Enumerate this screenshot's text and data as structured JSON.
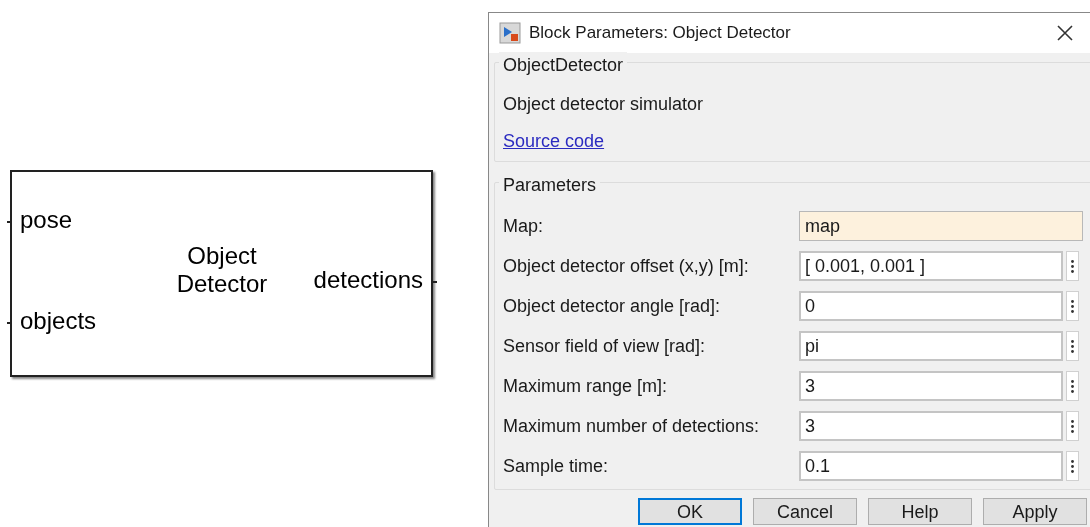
{
  "block": {
    "name": [
      "Object",
      "Detector"
    ],
    "inputs": [
      "pose",
      "objects"
    ],
    "outputs": [
      "detections"
    ]
  },
  "dialog": {
    "title": "Block Parameters: Object Detector",
    "group": {
      "title": "ObjectDetector",
      "description": "Object detector simulator",
      "link": "Source code"
    },
    "parameters_title": "Parameters",
    "fields": [
      {
        "label": "Map:",
        "value": "map",
        "kind": "expression"
      },
      {
        "label": "Object detector offset (x,y) [m]:",
        "value": "[ 0.001, 0.001 ]",
        "kind": "edit"
      },
      {
        "label": "Object detector angle [rad]:",
        "value": "0",
        "kind": "edit"
      },
      {
        "label": "Sensor field of view [rad]:",
        "value": "pi",
        "kind": "edit"
      },
      {
        "label": "Maximum range [m]:",
        "value": "3",
        "kind": "edit"
      },
      {
        "label": "Maximum number of detections:",
        "value": "3",
        "kind": "edit"
      },
      {
        "label": "Sample time:",
        "value": "0.1",
        "kind": "edit"
      }
    ],
    "buttons": [
      {
        "label": "OK",
        "default": true
      },
      {
        "label": "Cancel",
        "default": false
      },
      {
        "label": "Help",
        "default": false
      },
      {
        "label": "Apply",
        "default": false
      }
    ]
  }
}
